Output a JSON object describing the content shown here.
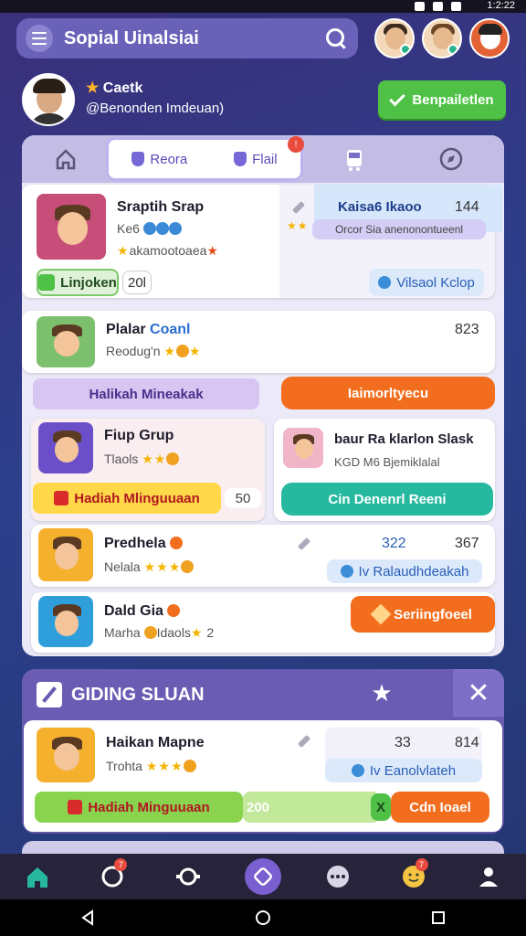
{
  "status": {
    "time": "1:2:22"
  },
  "topbar": {
    "title": "Sopial Uinalsiai",
    "menu_icon": "hamburger-icon",
    "search_icon": "search-icon"
  },
  "profile": {
    "name": "Caetk",
    "handle": "@Benonden Imdeuan)",
    "primary_button": "Benpailetlen"
  },
  "tabs": {
    "items": [
      {
        "icon": "home-outline-icon"
      },
      {
        "label": "Reora",
        "icon": "shield-icon"
      },
      {
        "label": "Flail",
        "icon": "shield-icon",
        "badge": "!"
      },
      {
        "icon": "bus-icon"
      },
      {
        "icon": "compass-icon"
      }
    ]
  },
  "list": [
    {
      "name": "Sraptih Srap",
      "sub": "Ke6",
      "sub2": "akamootoaea",
      "side_title": "Kaisa6 Ikaoo",
      "side_num": "144",
      "side_tag": "Orcor Sia anenonontueenl",
      "badge_label": "Linjoken",
      "badge_count": "20l",
      "action": "Vilsaol Kclop"
    },
    {
      "name": "Plalar",
      "name_highlight": "Coanl",
      "sub": "Reodug'n",
      "num": "823",
      "left_pill": "Halikah Mineakak",
      "right_pill": "Iaimorltyecu"
    },
    {
      "name": "Fiup Grup",
      "sub": "Tlaols",
      "pill": "Hadiah Mlinguuaan",
      "pill_count": "50",
      "right_title": "baur Ra klarlon Slask",
      "right_sub": "KGD M6 Bjemiklalal",
      "right_pill": "Cin Denenrl Reeni"
    },
    {
      "name": "Predhela",
      "sub": "Nelala",
      "num_a": "322",
      "num_b": "367",
      "action": "Iv Ralaudhdeakah"
    },
    {
      "name": "Dald Gia",
      "sub": "Marha",
      "sub_tag": "Idaols",
      "num": "2",
      "action": "Seriingfoeel"
    }
  ],
  "section2": {
    "title": "GIDING SLUAN",
    "card": {
      "name": "Haikan Mapne",
      "sub": "Trohta",
      "num_a": "33",
      "num_b": "814",
      "action": "Iv Eanolvlateh",
      "pill": "Hadiah Minguuaan",
      "pill_count": "200",
      "x_label": "X",
      "right_pill": "Cdn Ioael"
    }
  },
  "bottom_nav": {
    "badge_a": "7",
    "badge_b": "7"
  },
  "colors": {
    "accent": "#6a5bb3",
    "green": "#4fc147",
    "orange": "#f26e1e",
    "teal": "#27b9a0",
    "lavender": "#c3bde6"
  }
}
